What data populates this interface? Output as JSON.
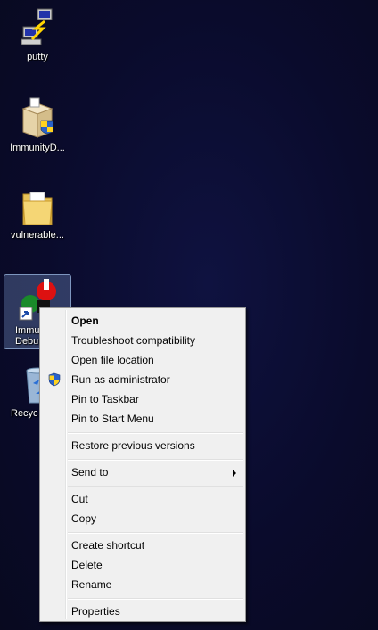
{
  "desktop": {
    "icons": [
      {
        "label": "putty",
        "icon": "computer-network-icon"
      },
      {
        "label": "ImmunityD...",
        "icon": "installer-box-icon"
      },
      {
        "label": "vulnerable...",
        "icon": "folder-icon"
      },
      {
        "label": "Immu... Debu...",
        "icon": "immunity-debugger-shortcut-icon"
      },
      {
        "label": "Recyc...",
        "icon": "recycle-bin-icon"
      }
    ],
    "partial_labels": {
      "immunity_line1": "Immu",
      "immunity_line2": "Debu",
      "recycle": "Recyc"
    }
  },
  "context_menu": {
    "items": [
      {
        "label": "Open",
        "bold": true
      },
      {
        "label": "Troubleshoot compatibility"
      },
      {
        "label": "Open file location"
      },
      {
        "label": "Run as administrator",
        "icon": "uac-shield-icon"
      },
      {
        "label": "Pin to Taskbar"
      },
      {
        "label": "Pin to Start Menu"
      },
      {
        "label": "Restore previous versions"
      },
      {
        "label": "Send to",
        "submenu": true
      },
      {
        "label": "Cut"
      },
      {
        "label": "Copy"
      },
      {
        "label": "Create shortcut"
      },
      {
        "label": "Delete"
      },
      {
        "label": "Rename"
      },
      {
        "label": "Properties"
      }
    ]
  },
  "colors": {
    "desktop_bg": "#0b0c26",
    "menu_bg": "#f0f0f0",
    "menu_border": "#979797"
  }
}
